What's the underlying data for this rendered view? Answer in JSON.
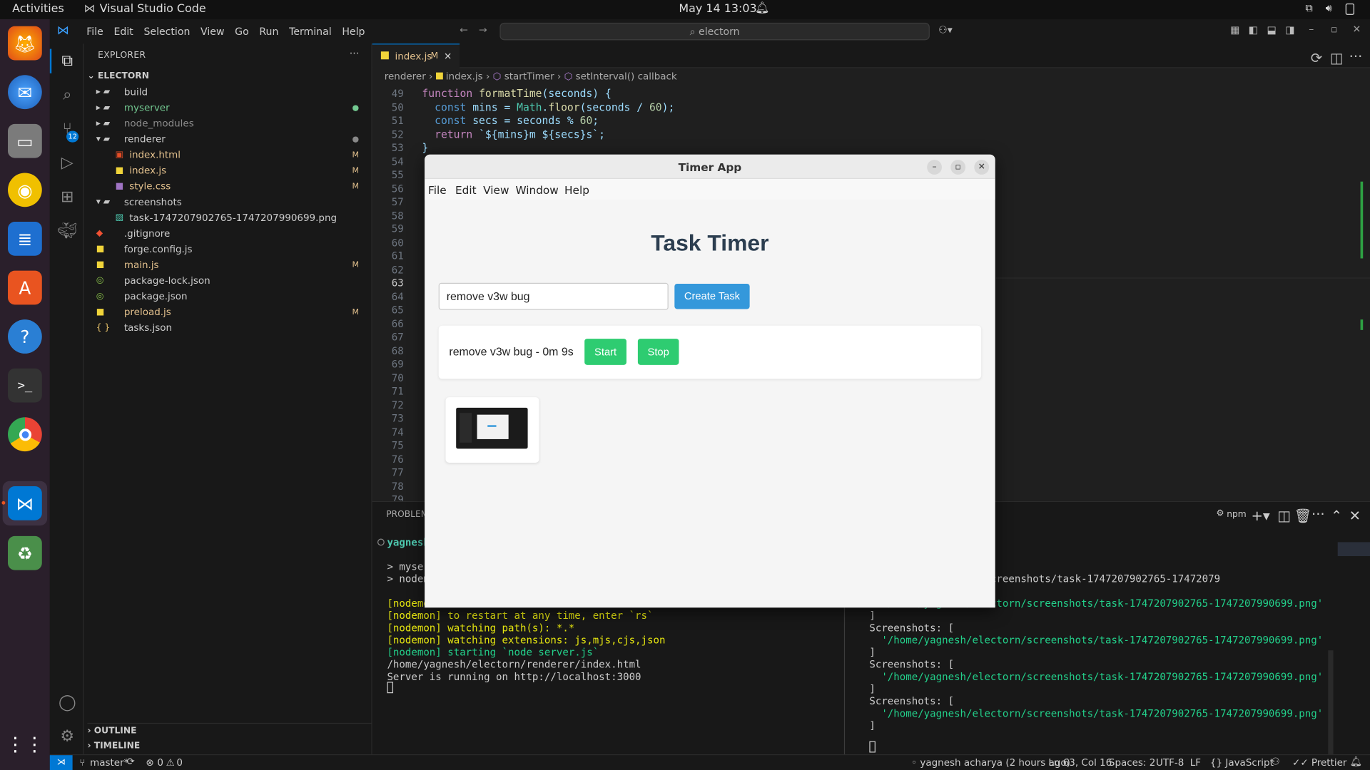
{
  "topbar": {
    "activities": "Activities",
    "app_name": "Visual Studio Code",
    "datetime": "May 14  13:03"
  },
  "dock": {
    "items": [
      "firefox-icon",
      "thunderbird-icon",
      "files-icon",
      "rhythmbox-icon",
      "writer-icon",
      "app-center-icon",
      "help-icon",
      "terminal-icon",
      "chrome-icon",
      "vscode-icon",
      "trash-icon",
      "apps-grid-icon"
    ]
  },
  "vscode": {
    "menu": [
      "File",
      "Edit",
      "Selection",
      "View",
      "Go",
      "Run",
      "Terminal",
      "Help"
    ],
    "search_text": "electorn",
    "source_control_badge": "12",
    "explorer": {
      "title": "EXPLORER",
      "root": "ELECTORN",
      "items": [
        {
          "label": "build",
          "type": "folder",
          "indent": 0,
          "status": "",
          "color": "#cccccc"
        },
        {
          "label": "myserver",
          "type": "folder",
          "indent": 0,
          "status": "dot-green",
          "color": "#73c991"
        },
        {
          "label": "node_modules",
          "type": "folder",
          "indent": 0,
          "status": "",
          "color": "#8c8c8c"
        },
        {
          "label": "renderer",
          "type": "folder-open",
          "indent": 0,
          "status": "dot-gray",
          "color": "#cccccc"
        },
        {
          "label": "index.html",
          "type": "html",
          "indent": 1,
          "status": "M",
          "color": "#e2c08d"
        },
        {
          "label": "index.js",
          "type": "js",
          "indent": 1,
          "status": "M",
          "color": "#e2c08d"
        },
        {
          "label": "style.css",
          "type": "css",
          "indent": 1,
          "status": "M",
          "color": "#e2c08d"
        },
        {
          "label": "screenshots",
          "type": "folder-open",
          "indent": 0,
          "status": "",
          "color": "#cccccc"
        },
        {
          "label": "task-1747207902765-1747207990699.png",
          "type": "png",
          "indent": 1,
          "status": "",
          "color": "#cccccc"
        },
        {
          "label": ".gitignore",
          "type": "git",
          "indent": 0,
          "status": "",
          "color": "#cccccc"
        },
        {
          "label": "forge.config.js",
          "type": "js",
          "indent": 0,
          "status": "",
          "color": "#cccccc"
        },
        {
          "label": "main.js",
          "type": "js",
          "indent": 0,
          "status": "M",
          "color": "#e2c08d"
        },
        {
          "label": "package-lock.json",
          "type": "json",
          "indent": 0,
          "status": "",
          "color": "#cccccc"
        },
        {
          "label": "package.json",
          "type": "json",
          "indent": 0,
          "status": "",
          "color": "#cccccc"
        },
        {
          "label": "preload.js",
          "type": "js",
          "indent": 0,
          "status": "M",
          "color": "#e2c08d"
        },
        {
          "label": "tasks.json",
          "type": "json2",
          "indent": 0,
          "status": "",
          "color": "#cccccc"
        }
      ],
      "outline": "OUTLINE",
      "timeline": "TIMELINE"
    },
    "tab": {
      "label": "index.js",
      "status": "M"
    },
    "breadcrumb": [
      "renderer",
      "index.js",
      "startTimer",
      "setInterval() callback"
    ],
    "code_lines": [
      {
        "n": "49",
        "text": "function formatTime(seconds) {"
      },
      {
        "n": "50",
        "text": "  const mins = Math.floor(seconds / 60);"
      },
      {
        "n": "51",
        "text": "  const secs = seconds % 60;"
      },
      {
        "n": "52",
        "text": "  return `${mins}m ${secs}s`;"
      },
      {
        "n": "53",
        "text": "}"
      },
      {
        "n": "54",
        "text": ""
      },
      {
        "n": "55",
        "text": ""
      },
      {
        "n": "56",
        "text": ""
      },
      {
        "n": "57",
        "text": ""
      },
      {
        "n": "58",
        "text": ""
      },
      {
        "n": "59",
        "text": ""
      },
      {
        "n": "60",
        "text": ""
      },
      {
        "n": "61",
        "text": ""
      },
      {
        "n": "62",
        "text": ""
      },
      {
        "n": "63",
        "text": ""
      },
      {
        "n": "64",
        "text": ""
      },
      {
        "n": "65",
        "text": ""
      },
      {
        "n": "66",
        "text": ""
      },
      {
        "n": "67",
        "text": ""
      },
      {
        "n": "68",
        "text": ""
      },
      {
        "n": "69",
        "text": ""
      },
      {
        "n": "70",
        "text": ""
      },
      {
        "n": "71",
        "text": ""
      },
      {
        "n": "72",
        "text": ""
      },
      {
        "n": "73",
        "text": ""
      },
      {
        "n": "74",
        "text": ""
      },
      {
        "n": "75",
        "text": ""
      },
      {
        "n": "76",
        "text": ""
      },
      {
        "n": "77",
        "text": ""
      },
      {
        "n": "78",
        "text": ""
      },
      {
        "n": "79",
        "text": ""
      }
    ],
    "panel": {
      "tab": "PROBLEMS",
      "terminal_label": "npm",
      "left_lines": [
        {
          "t": "yagnesh",
          "c": "#4ec9b0"
        },
        {
          "t": "",
          "c": "#ccc"
        },
        {
          "t": "> myser",
          "c": "#ccc"
        },
        {
          "t": "> nodem",
          "c": "#ccc"
        },
        {
          "t": "",
          "c": "#ccc"
        },
        {
          "t": "[nodemon",
          "c": "#e5e510"
        },
        {
          "t": "[nodemon] to restart at any time, enter `rs`",
          "c": "#e5e510"
        },
        {
          "t": "[nodemon] watching path(s): *.*",
          "c": "#e5e510"
        },
        {
          "t": "[nodemon] watching extensions: js,mjs,cjs,json",
          "c": "#e5e510"
        },
        {
          "t": "[nodemon] starting `node server.js`",
          "c": "#23d18b"
        },
        {
          "t": "/home/yagnesh/electorn/renderer/index.html",
          "c": "#ccc"
        },
        {
          "t": "Server is running on http://localhost:3000",
          "c": "#ccc"
        }
      ],
      "right_lines": [
        {
          "t": "e/yagnesh/electorn/screenshots/task-1747207902765-17472079",
          "c": "#ccc"
        },
        {
          "t": "",
          "c": "#ccc"
        },
        {
          "t": "  '/home/yagnesh/electorn/screenshots/task-1747207902765-1747207990699.png'",
          "c": "#23d18b"
        },
        {
          "t": "]",
          "c": "#ccc"
        },
        {
          "t": "Screenshots: [",
          "c": "#ccc"
        },
        {
          "t": "  '/home/yagnesh/electorn/screenshots/task-1747207902765-1747207990699.png'",
          "c": "#23d18b"
        },
        {
          "t": "]",
          "c": "#ccc"
        },
        {
          "t": "Screenshots: [",
          "c": "#ccc"
        },
        {
          "t": "  '/home/yagnesh/electorn/screenshots/task-1747207902765-1747207990699.png'",
          "c": "#23d18b"
        },
        {
          "t": "]",
          "c": "#ccc"
        },
        {
          "t": "Screenshots: [",
          "c": "#ccc"
        },
        {
          "t": "  '/home/yagnesh/electorn/screenshots/task-1747207902765-1747207990699.png'",
          "c": "#23d18b"
        },
        {
          "t": "]",
          "c": "#ccc"
        }
      ]
    },
    "status": {
      "branch": "master*",
      "problems": "0",
      "warnings": "0",
      "blame": "yagnesh acharya (2 hours ago)",
      "position": "Ln 63, Col 16",
      "spaces": "Spaces: 2",
      "encoding": "UTF-8",
      "eol": "LF",
      "language": "JavaScript",
      "prettier": "Prettier"
    }
  },
  "timer_app": {
    "window_title": "Timer App",
    "menu": [
      "File",
      "Edit",
      "View",
      "Window",
      "Help"
    ],
    "heading": "Task Timer",
    "input_value": "remove v3w bug",
    "create_button": "Create Task",
    "task_text": "remove v3w bug - 0m 9s",
    "start_button": "Start",
    "stop_button": "Stop"
  },
  "colors": {
    "accent": "#3498db",
    "green": "#2ecc71",
    "vscode_blue": "#0078d4"
  }
}
